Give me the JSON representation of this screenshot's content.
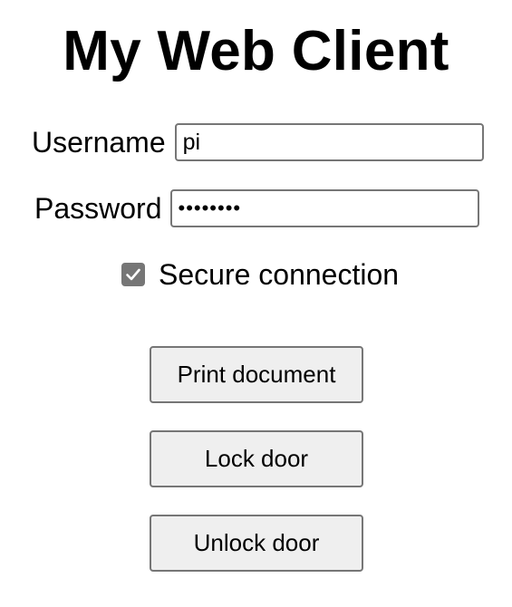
{
  "page": {
    "title": "My Web Client"
  },
  "login": {
    "username_label": "Username",
    "username_value": "pi",
    "password_label": "Password",
    "password_value": "12345678"
  },
  "options": {
    "secure_label": "Secure connection",
    "secure_checked": true
  },
  "actions": {
    "print_label": "Print document",
    "lock_label": "Lock door",
    "unlock_label": "Unlock door"
  },
  "colors": {
    "control_border": "#767676",
    "button_background": "#efefef",
    "checkbox_fill": "#767676"
  },
  "icons": {
    "checkbox_mark": "checkmark-icon"
  }
}
